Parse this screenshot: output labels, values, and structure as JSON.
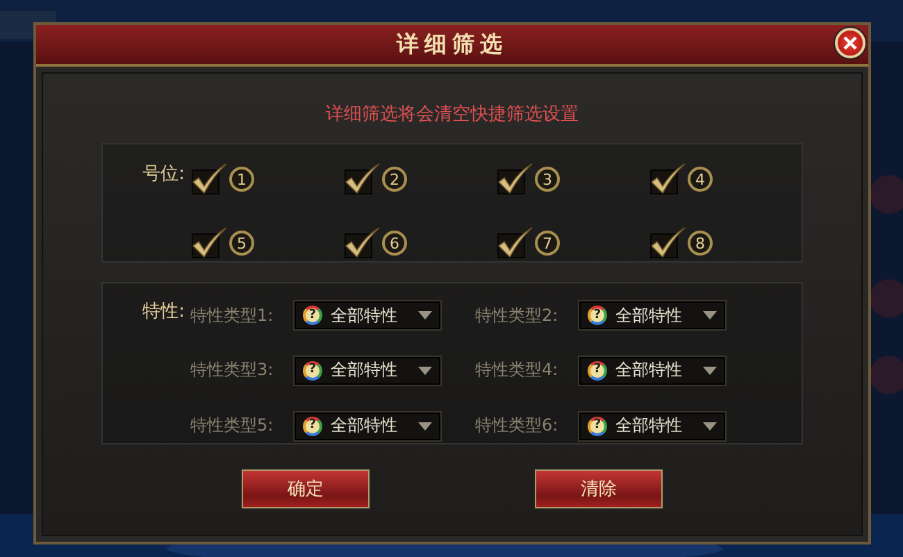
{
  "window": {
    "title": "详细筛选"
  },
  "notice": "详细筛选将会清空快捷筛选设置",
  "positions": {
    "label": "号位:",
    "items": [
      {
        "number": "1",
        "checked": true
      },
      {
        "number": "2",
        "checked": true
      },
      {
        "number": "3",
        "checked": true
      },
      {
        "number": "4",
        "checked": true
      },
      {
        "number": "5",
        "checked": true
      },
      {
        "number": "6",
        "checked": true
      },
      {
        "number": "7",
        "checked": true
      },
      {
        "number": "8",
        "checked": true
      }
    ]
  },
  "traits": {
    "label": "特性:",
    "selects": [
      {
        "label": "特性类型1:",
        "icon": "?",
        "value": "全部特性"
      },
      {
        "label": "特性类型2:",
        "icon": "?",
        "value": "全部特性"
      },
      {
        "label": "特性类型3:",
        "icon": "?",
        "value": "全部特性"
      },
      {
        "label": "特性类型4:",
        "icon": "?",
        "value": "全部特性"
      },
      {
        "label": "特性类型5:",
        "icon": "?",
        "value": "全部特性"
      },
      {
        "label": "特性类型6:",
        "icon": "?",
        "value": "全部特性"
      }
    ]
  },
  "buttons": [
    "确定",
    "清除"
  ]
}
